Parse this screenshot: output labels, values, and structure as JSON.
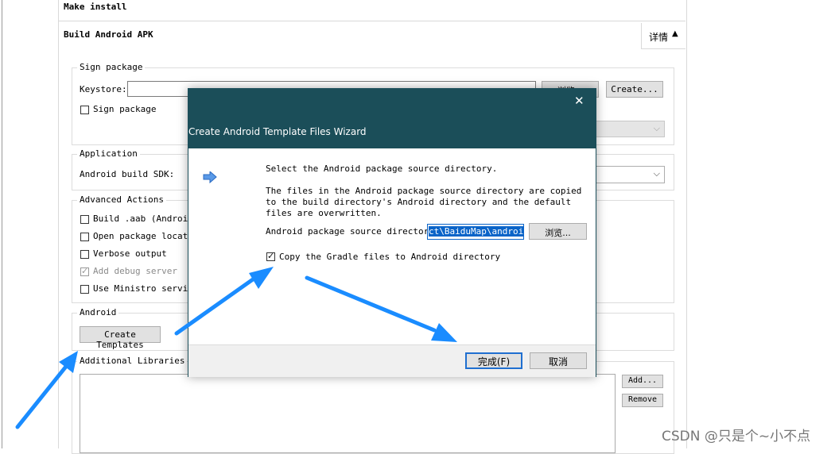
{
  "make_install": {
    "label": "Make install"
  },
  "build_apk": {
    "label": "Build Android APK",
    "details_label": "详情"
  },
  "sign_package": {
    "group_title": "Sign package",
    "keystore_label": "Keystore:",
    "keystore_value": "",
    "browse_label": "浏览...",
    "create_label": "Create...",
    "sign_checkbox_label": "Sign package"
  },
  "application": {
    "group_title": "Application",
    "sdk_label": "Android build SDK:"
  },
  "advanced": {
    "group_title": "Advanced Actions",
    "items": [
      {
        "label": "Build .aab (Android",
        "checked": false,
        "disabled": false
      },
      {
        "label": "Open package locatio",
        "checked": false,
        "disabled": false
      },
      {
        "label": "Verbose output",
        "checked": false,
        "disabled": false
      },
      {
        "label": "Add debug server",
        "checked": true,
        "disabled": true
      },
      {
        "label": "Use Ministro service",
        "checked": false,
        "disabled": false
      }
    ]
  },
  "android": {
    "group_title": "Android",
    "create_templates_label": "Create Templates"
  },
  "libraries": {
    "group_title": "Additional Libraries",
    "add_label": "Add...",
    "remove_label": "Remove"
  },
  "dialog": {
    "title": "Create Android Template Files Wizard",
    "heading": "Select the Android package source directory.",
    "description": "The files in the Android package source directory are copied to the build directory's Android directory and the default files are overwritten.",
    "source_dir_label": "Android package source directory:",
    "source_dir_value": "ct\\BaiduMap\\android",
    "browse_label": "浏览...",
    "copy_gradle_label": "Copy the Gradle files to Android directory",
    "copy_gradle_checked": true,
    "finish_label": "完成(F)",
    "cancel_label": "取消",
    "close_symbol": "✕",
    "accent_color": "#1b4e59"
  },
  "annotation_color": "#1a8cff",
  "watermark": "CSDN @只是个~小不点"
}
